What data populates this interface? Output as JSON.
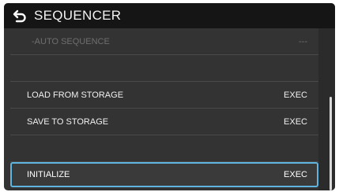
{
  "header": {
    "title": "SEQUENCER",
    "back_icon": "back-arrow-icon"
  },
  "rows": [
    {
      "label": "-AUTO SEQUENCE",
      "value": "---",
      "state": "disabled"
    },
    {
      "label": "",
      "value": "",
      "state": "blank"
    },
    {
      "label": "LOAD FROM STORAGE",
      "value": "EXEC",
      "state": "normal"
    },
    {
      "label": "SAVE TO STORAGE",
      "value": "EXEC",
      "state": "normal"
    },
    {
      "label": "",
      "value": "",
      "state": "blank"
    },
    {
      "label": "INITIALIZE",
      "value": "EXEC",
      "state": "selected"
    }
  ],
  "colors": {
    "selection": "#5fb4e0",
    "header_bg": "#151515",
    "panel_bg": "#333333"
  }
}
